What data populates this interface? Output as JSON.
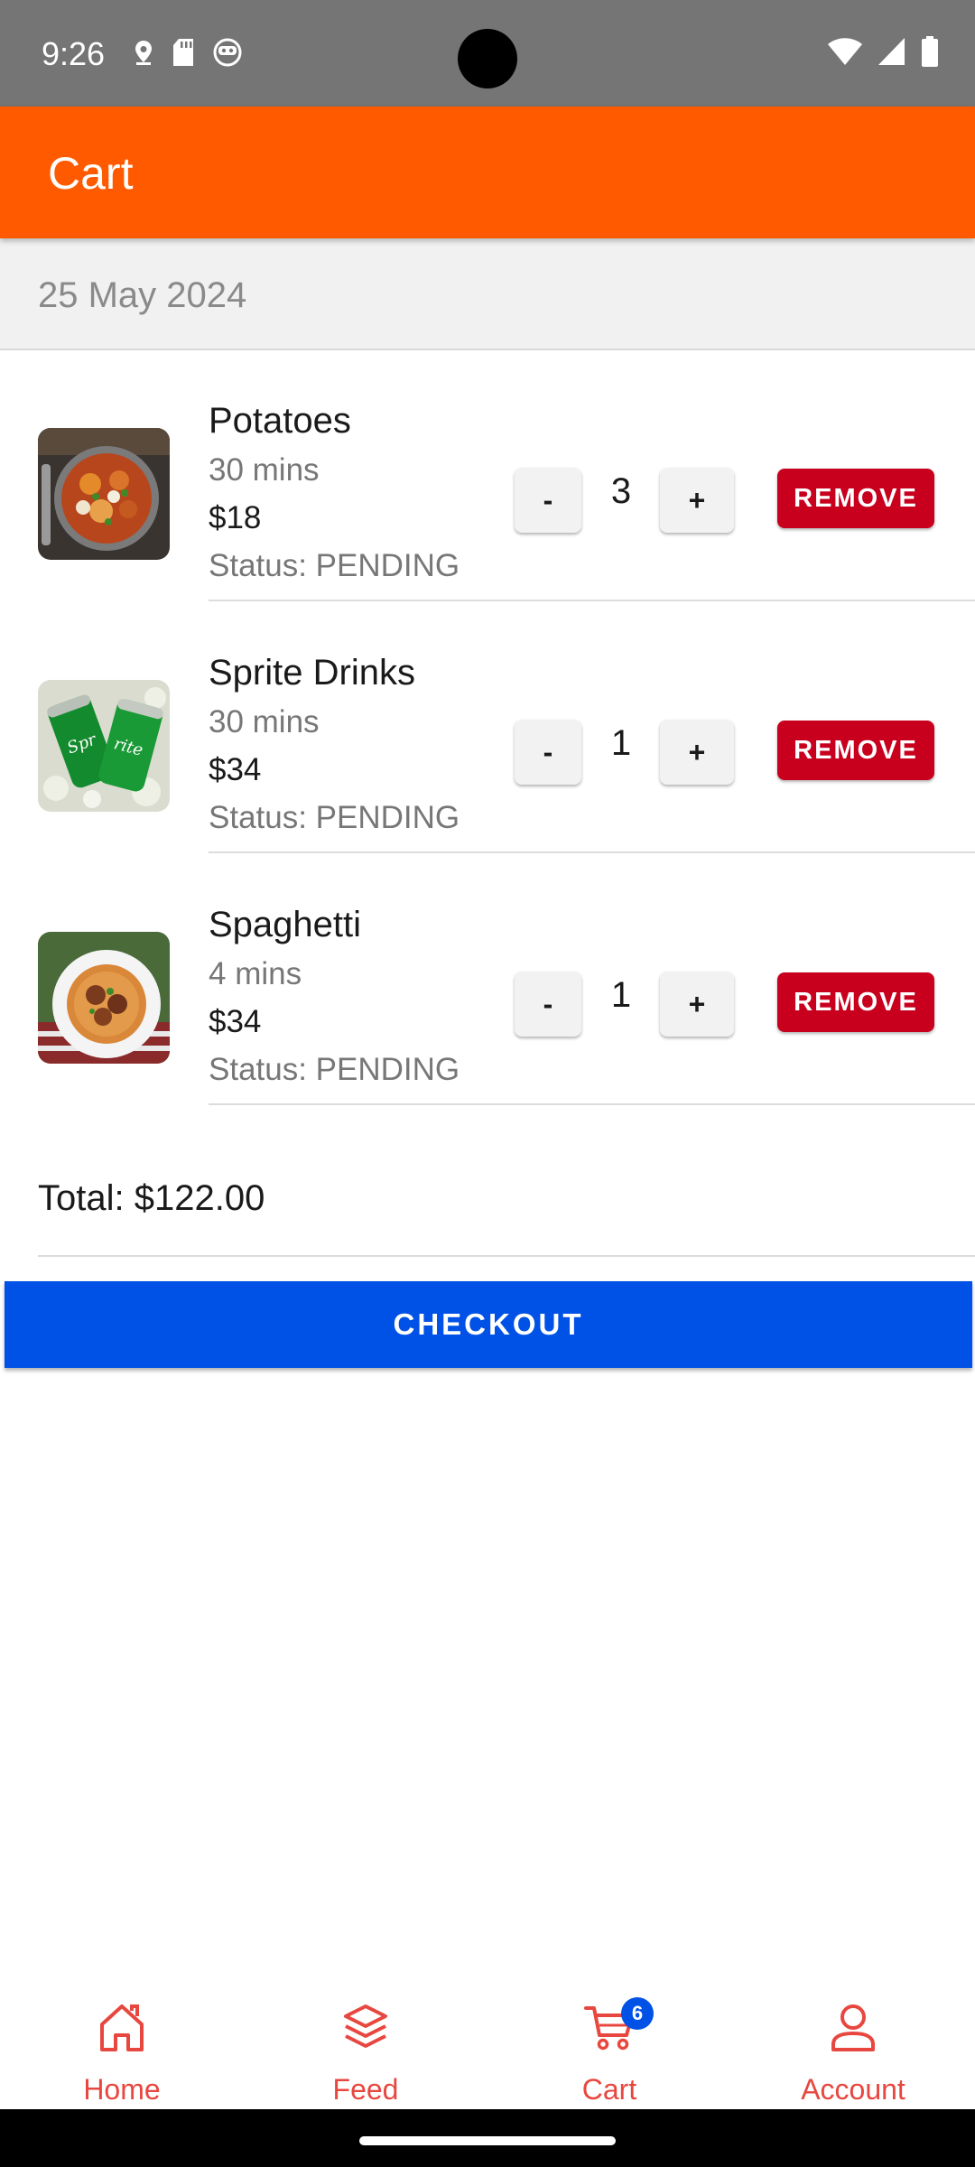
{
  "status_bar": {
    "time": "9:26",
    "left_icons": [
      "location-icon",
      "sd-card-icon",
      "face-icon"
    ],
    "right_icons": [
      "wifi-icon",
      "signal-icon",
      "battery-icon"
    ]
  },
  "app_bar": {
    "title": "Cart",
    "color": "#ff5a00"
  },
  "cart": {
    "date": "25 May 2024",
    "items": [
      {
        "name": "Potatoes",
        "time": "30 mins",
        "price": "$18",
        "status": "Status: PENDING",
        "quantity": "3",
        "minus_label": "-",
        "plus_label": "+",
        "remove_label": "REMOVE",
        "image": "potatoes-image"
      },
      {
        "name": "Sprite Drinks",
        "time": "30 mins",
        "price": "$34",
        "status": "Status: PENDING",
        "quantity": "1",
        "minus_label": "-",
        "plus_label": "+",
        "remove_label": "REMOVE",
        "image": "sprite-drinks-image"
      },
      {
        "name": "Spaghetti",
        "time": "4 mins",
        "price": "$34",
        "status": "Status: PENDING",
        "quantity": "1",
        "minus_label": "-",
        "plus_label": "+",
        "remove_label": "REMOVE",
        "image": "spaghetti-image"
      }
    ],
    "total": "Total: $122.00",
    "checkout_label": "CHECKOUT",
    "remove_color": "#c8001e",
    "checkout_color": "#0052e6"
  },
  "bottom_nav": {
    "items": [
      {
        "label": "Home",
        "icon": "home-icon"
      },
      {
        "label": "Feed",
        "icon": "layers-icon"
      },
      {
        "label": "Cart",
        "icon": "cart-icon"
      },
      {
        "label": "Account",
        "icon": "person-icon"
      }
    ],
    "cart_badge": "6",
    "color": "#e8473f"
  }
}
